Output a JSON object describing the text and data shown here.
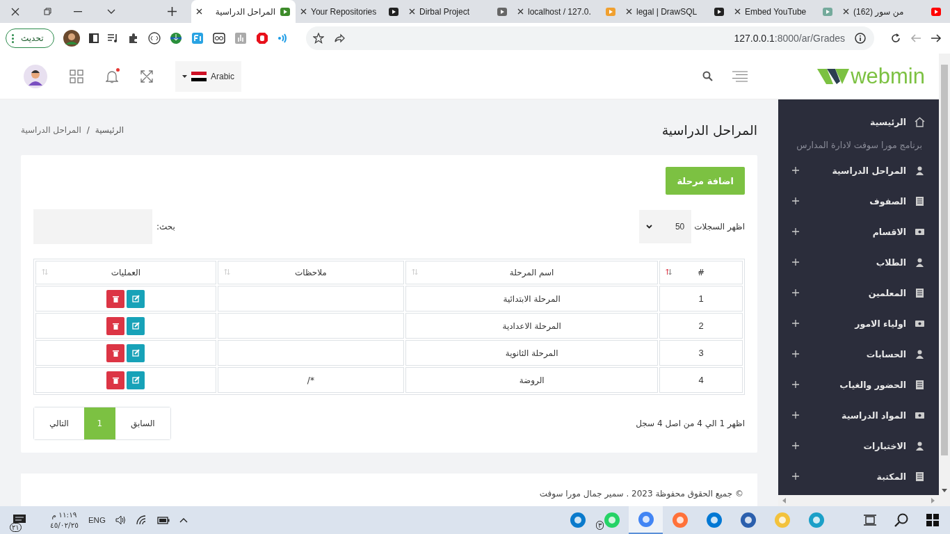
{
  "browser": {
    "tabs": [
      {
        "title": "(162) من سور",
        "selected": false
      },
      {
        "title": "Embed YouTube",
        "selected": false
      },
      {
        "title": "legal | DrawSQL",
        "selected": false
      },
      {
        "title": "localhost / 127.0.",
        "selected": false
      },
      {
        "title": "Dirbal Project",
        "selected": false
      },
      {
        "title": "Your Repositories",
        "selected": false
      },
      {
        "title": "المراحل الدراسية",
        "selected": true
      }
    ],
    "update_button": "تحديث",
    "url_host": "127.0.0.1",
    "url_path": ":8000/ar/Grades"
  },
  "header": {
    "language": "Arabic",
    "logo": "webmin",
    "has_notification": true
  },
  "page": {
    "title": "المراحل الدراسية",
    "breadcrumb_separator": "/",
    "breadcrumb": [
      {
        "label": "الرئيسية",
        "current": false
      },
      {
        "label": "المراحل الدراسية",
        "current": true
      }
    ]
  },
  "controls": {
    "add_button": "اضافة مرحلة",
    "length_label": "اظهر السجلات",
    "length_value": "50",
    "search_label": "بحث:"
  },
  "table": {
    "columns": [
      {
        "label": "#",
        "sorted": true
      },
      {
        "label": "اسم المرحلة",
        "sorted": false
      },
      {
        "label": "ملاحظات",
        "sorted": false
      },
      {
        "label": "العمليات",
        "sorted": false
      }
    ],
    "rows": [
      {
        "number": "1",
        "name": "المرحلة الابتدائية"
      },
      {
        "number": "2",
        "name": "المرحلة الاعدادية"
      },
      {
        "number": "3",
        "name": "المرحلة الثانوية"
      },
      {
        "number": "4",
        "name": "الروضة",
        "notes": "*/"
      }
    ]
  },
  "info": "اظهر 1 الي 4 من اصل 4 سجل",
  "pagination": [
    {
      "label": "السابق",
      "selected": false
    },
    {
      "label": "1",
      "selected": true
    },
    {
      "label": "التالي",
      "selected": false
    }
  ],
  "footer": "© جميع الحقوق محفوظة 2023 . سمير جمال مورا سوفت",
  "sidebar": {
    "items": [
      {
        "kind": "link",
        "label": "الرئيسية"
      },
      {
        "kind": "heading",
        "label": "برنامج مورا سوفت لادارة المدارس"
      },
      {
        "kind": "group",
        "label": "المراحل الدراسية"
      },
      {
        "kind": "group",
        "label": "الصفوف"
      },
      {
        "kind": "group",
        "label": "الاقسام"
      },
      {
        "kind": "group",
        "label": "الطلاب"
      },
      {
        "kind": "group",
        "label": "المعلمين"
      },
      {
        "kind": "group",
        "label": "اولياء الامور"
      },
      {
        "kind": "group",
        "label": "الحسابات"
      },
      {
        "kind": "group",
        "label": "الحضور والغياب"
      },
      {
        "kind": "group",
        "label": "المواد الدراسية"
      },
      {
        "kind": "group",
        "label": "الاختبارات"
      },
      {
        "kind": "group",
        "label": "المكتبة"
      }
    ]
  },
  "taskbar": {
    "notification_count": "٢١",
    "time": "١١:١٩ م",
    "date": "٤٥/٠٢/٢٥",
    "language": "ENG",
    "apps": [
      {
        "kind": "vscode",
        "selected": false
      },
      {
        "kind": "whatsapp",
        "badge": "٣",
        "selected": false
      },
      {
        "kind": "chrome",
        "selected": true
      },
      {
        "kind": "firefox",
        "selected": false
      },
      {
        "kind": "mail",
        "selected": false
      },
      {
        "kind": "store",
        "selected": false
      },
      {
        "kind": "explorer",
        "selected": false
      },
      {
        "kind": "edge",
        "selected": false
      }
    ]
  }
}
